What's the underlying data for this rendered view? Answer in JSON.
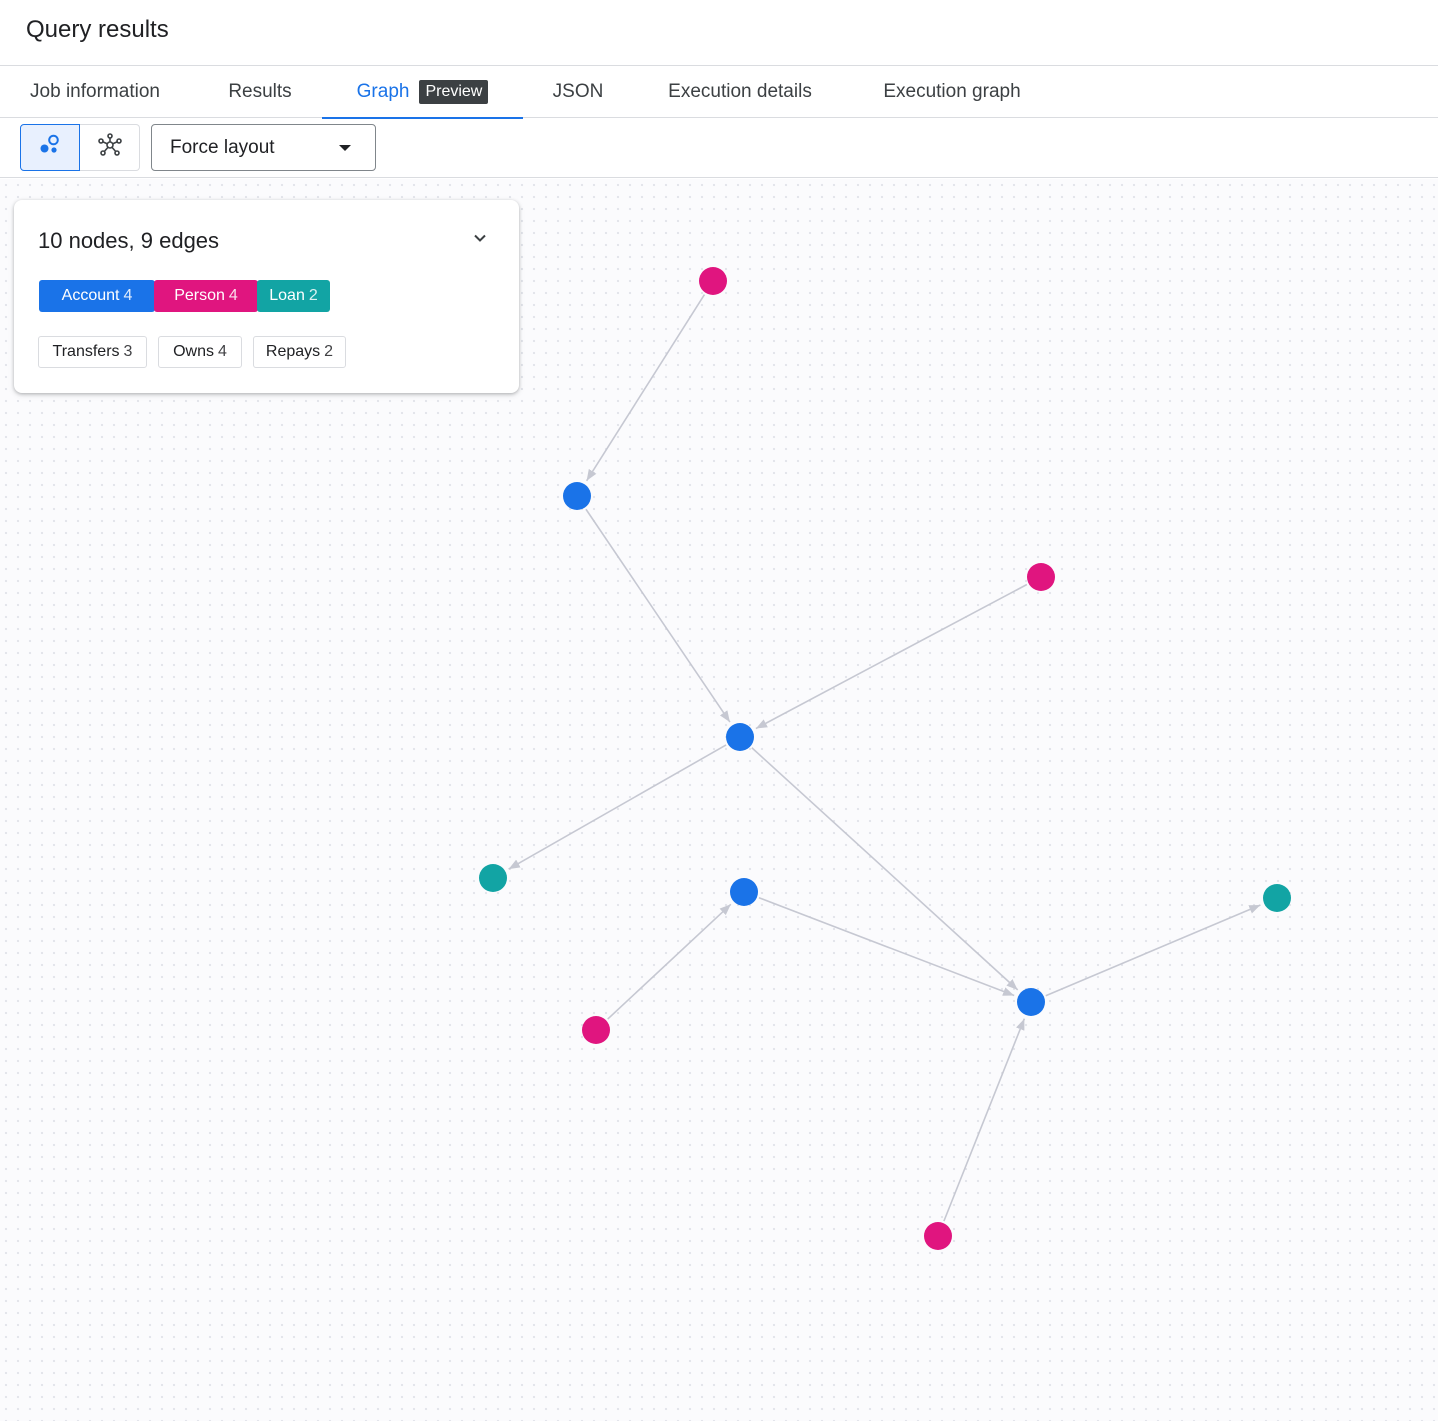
{
  "header": {
    "title": "Query results"
  },
  "tabs": [
    {
      "label": "Job information"
    },
    {
      "label": "Results"
    },
    {
      "label": "Graph",
      "badge": "Preview",
      "active": true
    },
    {
      "label": "JSON"
    },
    {
      "label": "Execution details"
    },
    {
      "label": "Execution graph"
    }
  ],
  "toolbar": {
    "view_modes": [
      "node-cluster-icon",
      "network-icon"
    ],
    "layout_value": "Force layout"
  },
  "legend": {
    "summary": "10 nodes, 9 edges",
    "node_types": [
      {
        "label": "Account",
        "count": "4",
        "color": "#1a73e8"
      },
      {
        "label": "Person",
        "count": "4",
        "color": "#e0157f"
      },
      {
        "label": "Loan",
        "count": "2",
        "color": "#12a4a4"
      }
    ],
    "edge_types": [
      {
        "label": "Transfers",
        "count": "3"
      },
      {
        "label": "Owns",
        "count": "4"
      },
      {
        "label": "Repays",
        "count": "2"
      }
    ]
  },
  "graph": {
    "colors": {
      "Account": "#1a73e8",
      "Person": "#e0157f",
      "Loan": "#12a4a4",
      "edge": "#c6c8d2"
    }
  }
}
